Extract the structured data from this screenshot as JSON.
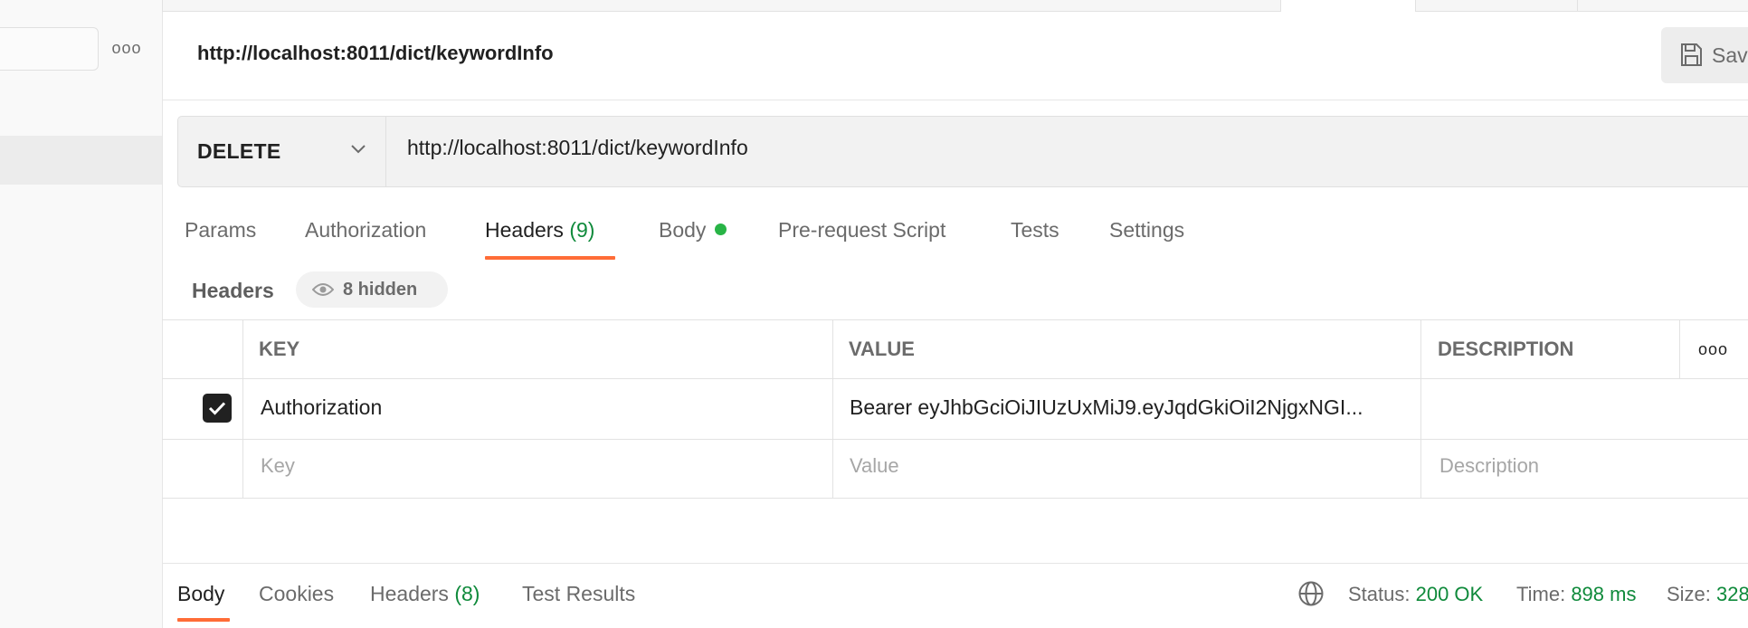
{
  "sidebar": {
    "more_icon": "more-horizontal-icon",
    "more_glyph": "ooo"
  },
  "request": {
    "title": "http://localhost:8011/dict/keywordInfo",
    "save_label": "Sav",
    "method": "DELETE",
    "url": "http://localhost:8011/dict/keywordInfo"
  },
  "request_tabs": [
    {
      "label": "Params"
    },
    {
      "label": "Authorization"
    },
    {
      "label": "Headers",
      "count": "(9)"
    },
    {
      "label": "Body"
    },
    {
      "label": "Pre-request Script"
    },
    {
      "label": "Tests"
    },
    {
      "label": "Settings"
    }
  ],
  "headers_section": {
    "title": "Headers",
    "hidden_label": "8 hidden"
  },
  "table": {
    "columns": [
      "KEY",
      "VALUE",
      "DESCRIPTION"
    ],
    "more_glyph": "ooo",
    "rows": [
      {
        "checked": true,
        "key": "Authorization",
        "value": "Bearer eyJhbGciOiJIUzUxMiJ9.eyJqdGkiOiI2NjgxNGI...",
        "description": ""
      }
    ],
    "placeholders": {
      "key": "Key",
      "value": "Value",
      "description": "Description"
    }
  },
  "response": {
    "tabs": [
      {
        "label": "Body"
      },
      {
        "label": "Cookies"
      },
      {
        "label": "Headers",
        "count": "(8)"
      },
      {
        "label": "Test Results"
      }
    ],
    "status_label": "Status:",
    "status_value": "200 OK",
    "time_label": "Time:",
    "time_value": "898 ms",
    "size_label": "Size:",
    "size_value": "328"
  },
  "colors": {
    "accent": "#ff6c37",
    "success": "#0f8a3b",
    "dot": "#28b446"
  }
}
